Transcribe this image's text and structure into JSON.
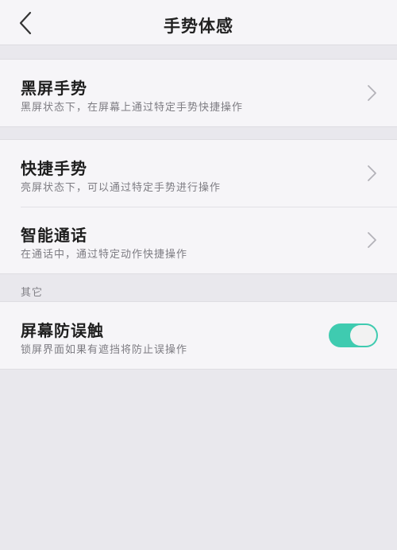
{
  "header": {
    "title": "手势体感",
    "back_icon": "chevron-left-icon"
  },
  "groups": [
    {
      "items": [
        {
          "title": "黑屏手势",
          "desc": "黑屏状态下，在屏幕上通过特定手势快捷操作",
          "control": "chevron-right-icon"
        }
      ]
    },
    {
      "items": [
        {
          "title": "快捷手势",
          "desc": "亮屏状态下，可以通过特定手势进行操作",
          "control": "chevron-right-icon"
        },
        {
          "title": "智能通话",
          "desc": "在通话中，通过特定动作快捷操作",
          "control": "chevron-right-icon"
        }
      ]
    }
  ],
  "other_section": {
    "label": "其它",
    "items": [
      {
        "title": "屏幕防误触",
        "desc": "锁屏界面如果有遮挡将防止误操作",
        "toggle_on": true,
        "toggle_color": "#3fcbb0"
      }
    ]
  },
  "colors": {
    "accent": "#3fcbb0",
    "background": "#e9e8ed",
    "card": "#f6f5f8"
  }
}
